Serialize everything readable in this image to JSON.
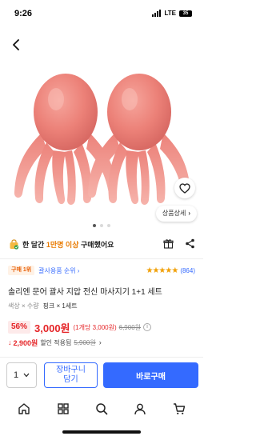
{
  "status_bar": {
    "time": "9:26",
    "network": "LTE",
    "battery": "35"
  },
  "product": {
    "image_alt": "솔리엔 문어 괄사 지압 전신 마사지기 1+1 세트",
    "image_dots": {
      "count": 3,
      "active_index": 0
    },
    "detail_button": "상품상세",
    "purchase_info": {
      "prefix": "한 달간",
      "highlight": "1만명 이상",
      "suffix": "구매했어요"
    },
    "rank_badge": "구매 1위",
    "rank_link": "괄사용품 순위",
    "rating": {
      "stars": 5,
      "count": "(864)"
    },
    "title": "솔리엔 문어 괄사 지압 전신 마사지기 1+1 세트",
    "option": {
      "label": "색상 × 수량",
      "value": "핑크 × 1세트"
    },
    "price": {
      "discount": "56%",
      "sale": "3,000원",
      "unit": "(1개당 3,000원)",
      "original": "6,900원"
    },
    "coupon": {
      "price": "2,900원",
      "label": "할인 적용됨",
      "original": "5,900원"
    }
  },
  "actions": {
    "quantity": "1",
    "cart_line1": "장바구니",
    "cart_line2": "담기",
    "buy": "바로구매"
  },
  "tab_bar": {
    "items": [
      "home-icon",
      "category-icon",
      "search-icon",
      "my-page-icon",
      "cart-icon"
    ]
  },
  "colors": {
    "accent_blue": "#346aff",
    "price_red": "#e52528",
    "star_orange": "#f1a007",
    "rank_orange": "#e85d04",
    "product_pink": "#f08a84"
  }
}
